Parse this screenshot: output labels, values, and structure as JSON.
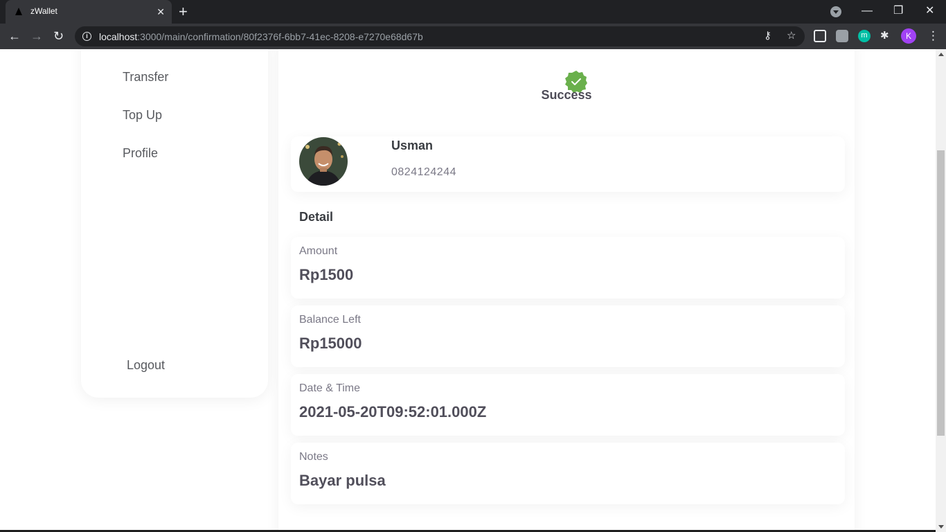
{
  "browser": {
    "tab_title": "zWallet",
    "tab_close": "✕",
    "new_tab": "+",
    "url_host": "localhost",
    "url_path": ":3000/main/confirmation/80f2376f-6bb7-41ec-8208-e7270e68d67b",
    "profile_initial": "K",
    "ext_m": "m",
    "back": "←",
    "forward": "→",
    "reload": "↻",
    "minimize": "—",
    "restore": "❐",
    "close": "✕",
    "key": "⚷",
    "star": "☆",
    "puzzle": "✱",
    "menu": "⋮"
  },
  "sidebar": {
    "items": [
      {
        "label": "Transfer"
      },
      {
        "label": "Top Up"
      },
      {
        "label": "Profile"
      }
    ],
    "logout_label": "Logout"
  },
  "main": {
    "status_title": "Success",
    "status_color": "#6ab04c",
    "contact": {
      "name": "Usman",
      "phone": "0824124244"
    },
    "detail_label": "Detail",
    "details": [
      {
        "label": "Amount",
        "value": "Rp1500"
      },
      {
        "label": "Balance Left",
        "value": "Rp15000"
      },
      {
        "label": "Date & Time",
        "value": "2021-05-20T09:52:01.000Z"
      },
      {
        "label": "Notes",
        "value": "Bayar pulsa"
      }
    ]
  }
}
